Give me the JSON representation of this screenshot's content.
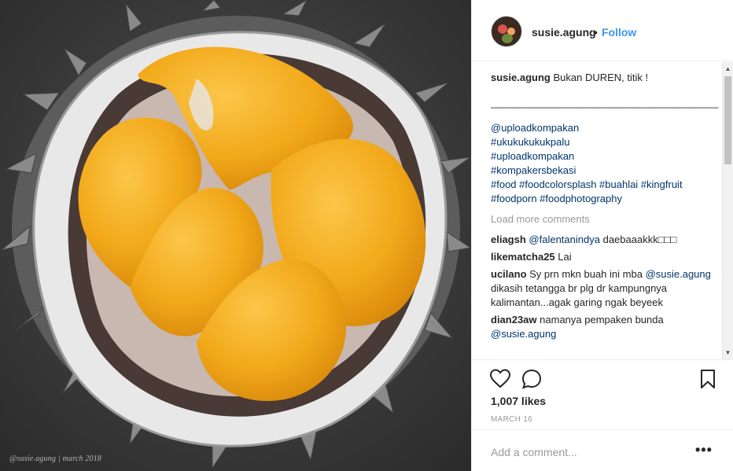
{
  "header": {
    "username": "susie.agung",
    "separator": "•",
    "follow_label": "Follow"
  },
  "photo": {
    "watermark": "@susie.agung | march 2018"
  },
  "caption": {
    "username": "susie.agung",
    "text": "Bukan DUREN, titik !",
    "divider": "________________________________________",
    "tags": [
      "@uploadkompakan",
      "#ukukukukukpalu",
      "#uploadkompakan",
      "#kompakersbekasi",
      "#food #foodcolorsplash #buahlai #kingfruit",
      "#foodporn #foodphotography"
    ]
  },
  "load_more": "Load more comments",
  "comments": [
    {
      "user": "eliagsh",
      "mention": "@falentanindya",
      "text": "daebaaakkk□□□"
    },
    {
      "user": "likematcha25",
      "mention": "",
      "text": "Lai"
    },
    {
      "user": "ucilano",
      "mention": "",
      "text": "Sy prn mkn buah ini mba",
      "mention2": "@susie.agung",
      "text2": "dikasih tetangga br plg dr kampungnya kalimantan...agak garing ngak beyeek"
    },
    {
      "user": "dian23aw",
      "mention": "",
      "text": "namanya pempaken bunda",
      "mention2": "@susie.agung",
      "text2": ""
    }
  ],
  "actions": {
    "likes": "1,007 likes",
    "date": "MARCH 16"
  },
  "add_comment": {
    "placeholder": "Add a comment...",
    "more": "•••"
  },
  "colors": {
    "accent": "#3897f0",
    "link": "#003569",
    "durian_flesh": "#f2a91a"
  }
}
